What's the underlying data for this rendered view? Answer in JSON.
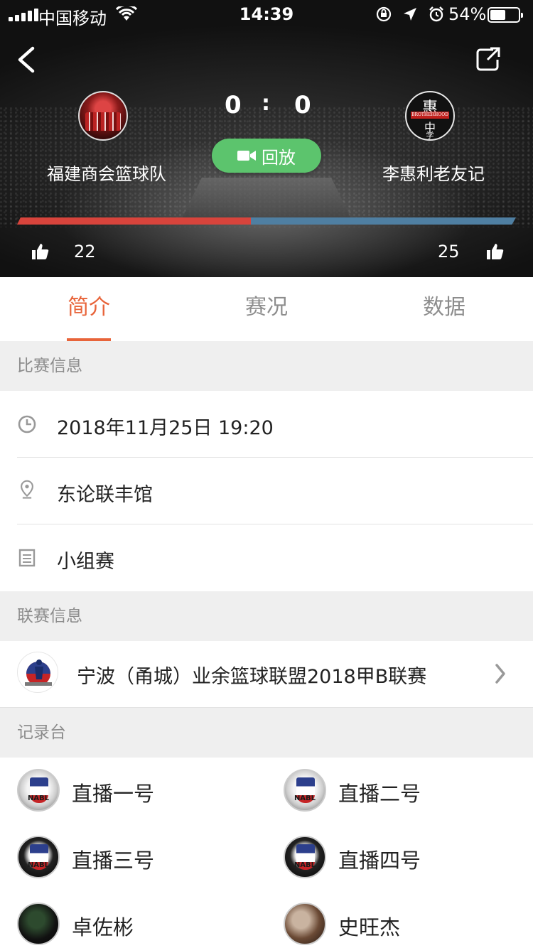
{
  "status_bar": {
    "carrier": "中国移动",
    "time": "14:39",
    "battery_pct": "54%",
    "battery_level": 0.54
  },
  "match": {
    "home_team": "福建商会篮球队",
    "away_team": "李惠利老友记",
    "home_score": "0",
    "score_separator": ":",
    "away_score": "0",
    "replay_label": "回放",
    "home_likes": "22",
    "away_likes": "25",
    "away_logo_text": "惠",
    "away_logo_band": "BROTHERHOOD",
    "away_logo_text2": "中",
    "away_logo_text3": "学",
    "home_vote_share": 0.468
  },
  "tabs": [
    {
      "label": "简介",
      "active": true
    },
    {
      "label": "赛况",
      "active": false
    },
    {
      "label": "数据",
      "active": false
    }
  ],
  "sections": {
    "match_info": "比赛信息",
    "league_info": "联赛信息",
    "recorders": "记录台"
  },
  "match_info": {
    "datetime": "2018年11月25日 19:20",
    "venue": "东论联丰馆",
    "stage": "小组赛"
  },
  "league": {
    "name": "宁波（甬城）业余篮球联盟2018甲B联赛"
  },
  "recorders": [
    {
      "name": "直播一号",
      "avatar": "nabl"
    },
    {
      "name": "直播二号",
      "avatar": "nabl"
    },
    {
      "name": "直播三号",
      "avatar": "nabl-dark"
    },
    {
      "name": "直播四号",
      "avatar": "nabl-dark"
    },
    {
      "name": "卓佐彬",
      "avatar": "photo"
    },
    {
      "name": "史旺杰",
      "avatar": "photo"
    }
  ],
  "nabl_label": "NABL",
  "colors": {
    "accent": "#e8643a",
    "replay_green": "#5cc46d",
    "home_bar": "#d8443c",
    "away_bar": "#4f7fa2"
  }
}
